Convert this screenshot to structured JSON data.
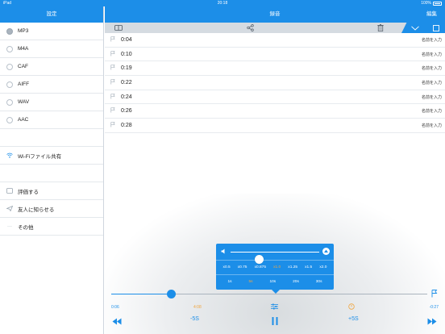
{
  "status_bar": {
    "device": "iPad",
    "time": "20:18",
    "battery": "100%"
  },
  "settings_pane": {
    "title": "設定",
    "formats": [
      {
        "label": "MP3",
        "selected": true
      },
      {
        "label": "M4A",
        "selected": false
      },
      {
        "label": "CAF",
        "selected": false
      },
      {
        "label": "AIFF",
        "selected": false
      },
      {
        "label": "WAV",
        "selected": false
      },
      {
        "label": "AAC",
        "selected": false
      }
    ],
    "wifi_share": "Wi-Fiファイル共有",
    "rate": "評価する",
    "tell_friends": "友人に知らせる",
    "other": "その他"
  },
  "recordings_pane": {
    "title": "録音",
    "edit": "編集",
    "records": [
      {
        "time": "0:04",
        "name": "名前を入力"
      },
      {
        "time": "0:10",
        "name": "名前を入力"
      },
      {
        "time": "0:19",
        "name": "名前を入力"
      },
      {
        "time": "0:22",
        "name": "名前を入力"
      },
      {
        "time": "0:24",
        "name": "名前を入力"
      },
      {
        "time": "0:26",
        "name": "名前を入力"
      },
      {
        "time": "0:28",
        "name": "名前を入力"
      }
    ]
  },
  "popup": {
    "volume_level": 0.32,
    "speeds": [
      "x0.5",
      "x0.75",
      "x0.875",
      "x1.0",
      "x1.25",
      "x1.5",
      "x2.0"
    ],
    "active_speed": "x1.0",
    "skips": [
      "1s",
      "5s",
      "10s",
      "20s",
      "30s"
    ],
    "active_skip": "5s"
  },
  "player": {
    "elapsed": "0:06",
    "marker_time": "4:08",
    "remaining": "-0:27",
    "progress": 0.19,
    "back_label": "-5S",
    "forward_label": "+5S"
  },
  "colors": {
    "accent": "#1c8ee8",
    "highlight": "#f0a640"
  }
}
